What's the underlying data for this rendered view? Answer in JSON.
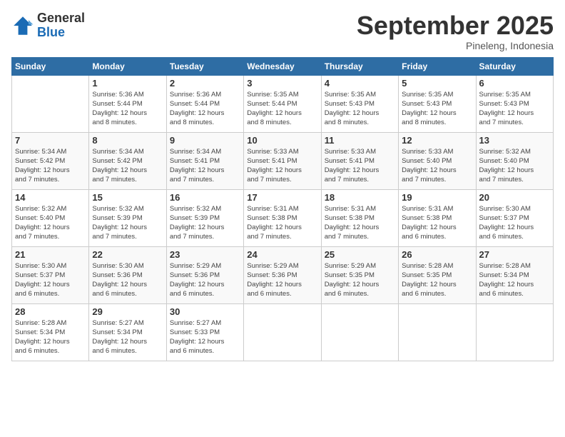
{
  "logo": {
    "general": "General",
    "blue": "Blue"
  },
  "header": {
    "month": "September 2025",
    "location": "Pineleng, Indonesia"
  },
  "weekdays": [
    "Sunday",
    "Monday",
    "Tuesday",
    "Wednesday",
    "Thursday",
    "Friday",
    "Saturday"
  ],
  "weeks": [
    [
      {
        "day": "",
        "info": ""
      },
      {
        "day": "1",
        "info": "Sunrise: 5:36 AM\nSunset: 5:44 PM\nDaylight: 12 hours\nand 8 minutes."
      },
      {
        "day": "2",
        "info": "Sunrise: 5:36 AM\nSunset: 5:44 PM\nDaylight: 12 hours\nand 8 minutes."
      },
      {
        "day": "3",
        "info": "Sunrise: 5:35 AM\nSunset: 5:44 PM\nDaylight: 12 hours\nand 8 minutes."
      },
      {
        "day": "4",
        "info": "Sunrise: 5:35 AM\nSunset: 5:43 PM\nDaylight: 12 hours\nand 8 minutes."
      },
      {
        "day": "5",
        "info": "Sunrise: 5:35 AM\nSunset: 5:43 PM\nDaylight: 12 hours\nand 8 minutes."
      },
      {
        "day": "6",
        "info": "Sunrise: 5:35 AM\nSunset: 5:43 PM\nDaylight: 12 hours\nand 7 minutes."
      }
    ],
    [
      {
        "day": "7",
        "info": "Sunrise: 5:34 AM\nSunset: 5:42 PM\nDaylight: 12 hours\nand 7 minutes."
      },
      {
        "day": "8",
        "info": "Sunrise: 5:34 AM\nSunset: 5:42 PM\nDaylight: 12 hours\nand 7 minutes."
      },
      {
        "day": "9",
        "info": "Sunrise: 5:34 AM\nSunset: 5:41 PM\nDaylight: 12 hours\nand 7 minutes."
      },
      {
        "day": "10",
        "info": "Sunrise: 5:33 AM\nSunset: 5:41 PM\nDaylight: 12 hours\nand 7 minutes."
      },
      {
        "day": "11",
        "info": "Sunrise: 5:33 AM\nSunset: 5:41 PM\nDaylight: 12 hours\nand 7 minutes."
      },
      {
        "day": "12",
        "info": "Sunrise: 5:33 AM\nSunset: 5:40 PM\nDaylight: 12 hours\nand 7 minutes."
      },
      {
        "day": "13",
        "info": "Sunrise: 5:32 AM\nSunset: 5:40 PM\nDaylight: 12 hours\nand 7 minutes."
      }
    ],
    [
      {
        "day": "14",
        "info": "Sunrise: 5:32 AM\nSunset: 5:40 PM\nDaylight: 12 hours\nand 7 minutes."
      },
      {
        "day": "15",
        "info": "Sunrise: 5:32 AM\nSunset: 5:39 PM\nDaylight: 12 hours\nand 7 minutes."
      },
      {
        "day": "16",
        "info": "Sunrise: 5:32 AM\nSunset: 5:39 PM\nDaylight: 12 hours\nand 7 minutes."
      },
      {
        "day": "17",
        "info": "Sunrise: 5:31 AM\nSunset: 5:38 PM\nDaylight: 12 hours\nand 7 minutes."
      },
      {
        "day": "18",
        "info": "Sunrise: 5:31 AM\nSunset: 5:38 PM\nDaylight: 12 hours\nand 7 minutes."
      },
      {
        "day": "19",
        "info": "Sunrise: 5:31 AM\nSunset: 5:38 PM\nDaylight: 12 hours\nand 6 minutes."
      },
      {
        "day": "20",
        "info": "Sunrise: 5:30 AM\nSunset: 5:37 PM\nDaylight: 12 hours\nand 6 minutes."
      }
    ],
    [
      {
        "day": "21",
        "info": "Sunrise: 5:30 AM\nSunset: 5:37 PM\nDaylight: 12 hours\nand 6 minutes."
      },
      {
        "day": "22",
        "info": "Sunrise: 5:30 AM\nSunset: 5:36 PM\nDaylight: 12 hours\nand 6 minutes."
      },
      {
        "day": "23",
        "info": "Sunrise: 5:29 AM\nSunset: 5:36 PM\nDaylight: 12 hours\nand 6 minutes."
      },
      {
        "day": "24",
        "info": "Sunrise: 5:29 AM\nSunset: 5:36 PM\nDaylight: 12 hours\nand 6 minutes."
      },
      {
        "day": "25",
        "info": "Sunrise: 5:29 AM\nSunset: 5:35 PM\nDaylight: 12 hours\nand 6 minutes."
      },
      {
        "day": "26",
        "info": "Sunrise: 5:28 AM\nSunset: 5:35 PM\nDaylight: 12 hours\nand 6 minutes."
      },
      {
        "day": "27",
        "info": "Sunrise: 5:28 AM\nSunset: 5:34 PM\nDaylight: 12 hours\nand 6 minutes."
      }
    ],
    [
      {
        "day": "28",
        "info": "Sunrise: 5:28 AM\nSunset: 5:34 PM\nDaylight: 12 hours\nand 6 minutes."
      },
      {
        "day": "29",
        "info": "Sunrise: 5:27 AM\nSunset: 5:34 PM\nDaylight: 12 hours\nand 6 minutes."
      },
      {
        "day": "30",
        "info": "Sunrise: 5:27 AM\nSunset: 5:33 PM\nDaylight: 12 hours\nand 6 minutes."
      },
      {
        "day": "",
        "info": ""
      },
      {
        "day": "",
        "info": ""
      },
      {
        "day": "",
        "info": ""
      },
      {
        "day": "",
        "info": ""
      }
    ]
  ]
}
